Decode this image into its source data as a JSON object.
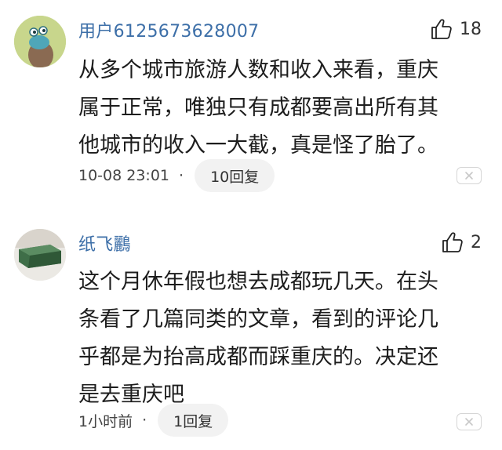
{
  "comments": [
    {
      "username": "用户6125673628007",
      "likes": "18",
      "lines": [
        "从多个城市旅游人数和收入来看，重庆",
        "属于正常，唯独只有成都要高出所有其",
        "他城市的收入一大截，真是怪了胎了。"
      ],
      "time": "10-08 23:01",
      "separator": "·",
      "reply": "10回复",
      "avatar_icon": "cartoon-snail-avatar"
    },
    {
      "username": "纸飞鸝",
      "likes": "2",
      "lines": [
        "这个月休年假也想去成都玩几天。在头",
        "条看了几篇同类的文章，看到的评论几",
        "乎都是为抬高成都而踩重庆的。决定还",
        "是去重庆吧"
      ],
      "time": "1小时前",
      "separator": "·",
      "reply": "1回复",
      "avatar_icon": "green-box-avatar"
    }
  ],
  "colors": {
    "username": "#3d6fa8",
    "reply_bg": "#f2f2f2",
    "text": "#1d1d1d"
  }
}
